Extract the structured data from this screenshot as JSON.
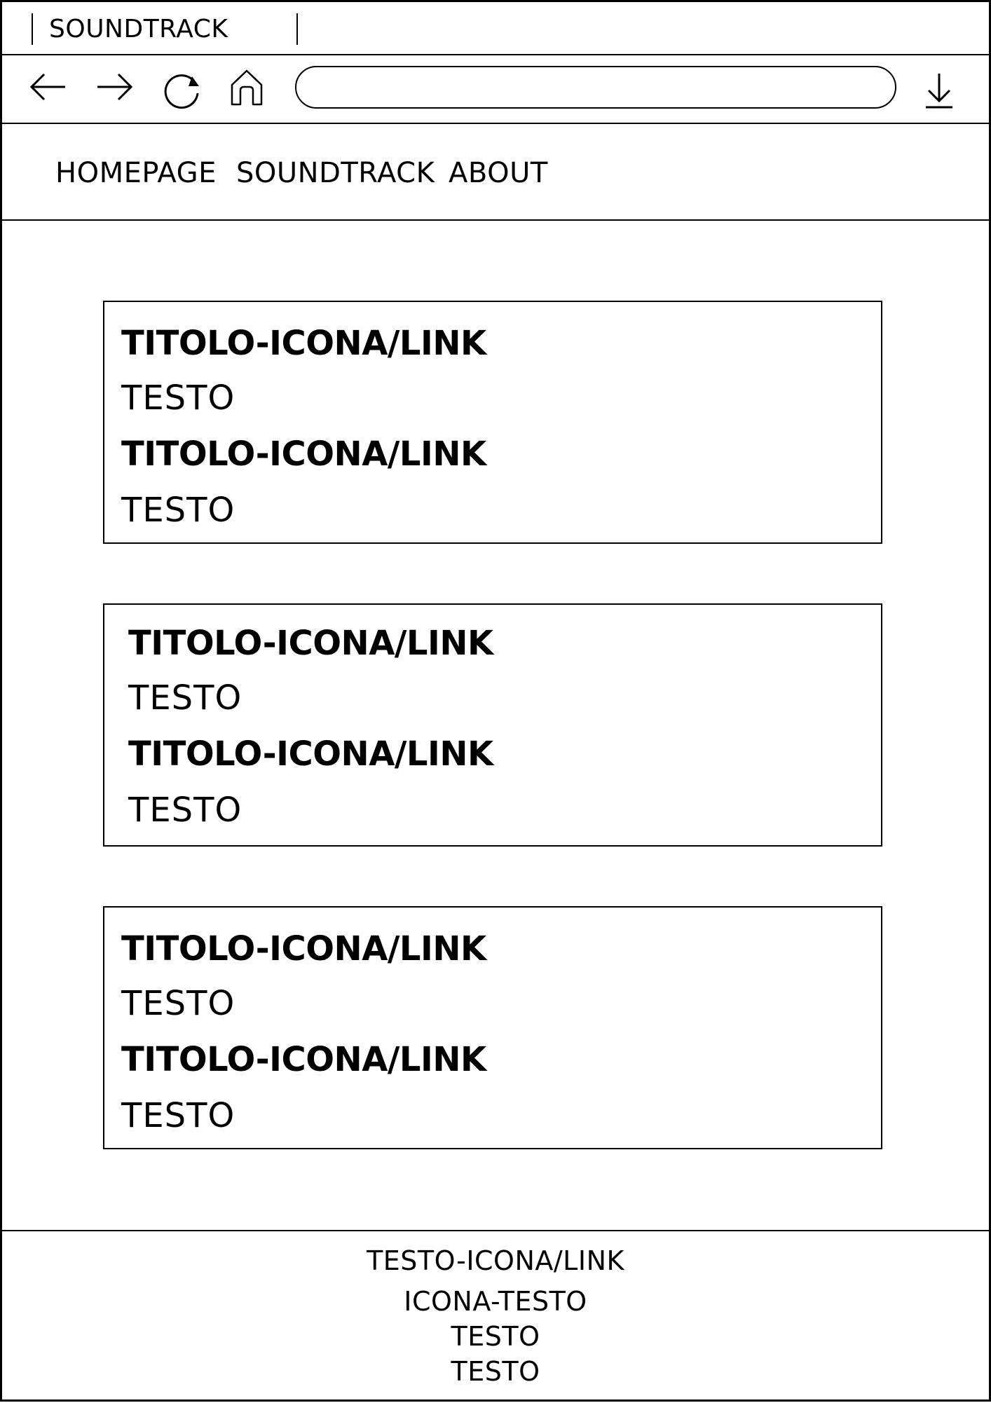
{
  "browser": {
    "tab_title": "SOUNDTRACK",
    "address_value": "",
    "icons": [
      "back-arrow-icon",
      "forward-arrow-icon",
      "reload-icon",
      "home-icon",
      "download-icon"
    ]
  },
  "nav": {
    "items": [
      {
        "label": "HOMEPAGE"
      },
      {
        "label": "SOUNDTRACK"
      },
      {
        "label": "ABOUT"
      }
    ]
  },
  "cards": [
    {
      "items": [
        {
          "title": "TITOLO-ICONA/LINK",
          "text": "TESTO"
        },
        {
          "title": "TITOLO-ICONA/LINK",
          "text": "TESTO"
        }
      ]
    },
    {
      "items": [
        {
          "title": "TITOLO-ICONA/LINK",
          "text": "TESTO"
        },
        {
          "title": "TITOLO-ICONA/LINK",
          "text": "TESTO"
        }
      ]
    },
    {
      "items": [
        {
          "title": "TITOLO-ICONA/LINK",
          "text": "TESTO"
        },
        {
          "title": "TITOLO-ICONA/LINK",
          "text": "TESTO"
        }
      ]
    }
  ],
  "footer": {
    "lines": [
      "TESTO-ICONA/LINK",
      "ICONA-TESTO",
      "TESTO",
      "TESTO"
    ]
  }
}
